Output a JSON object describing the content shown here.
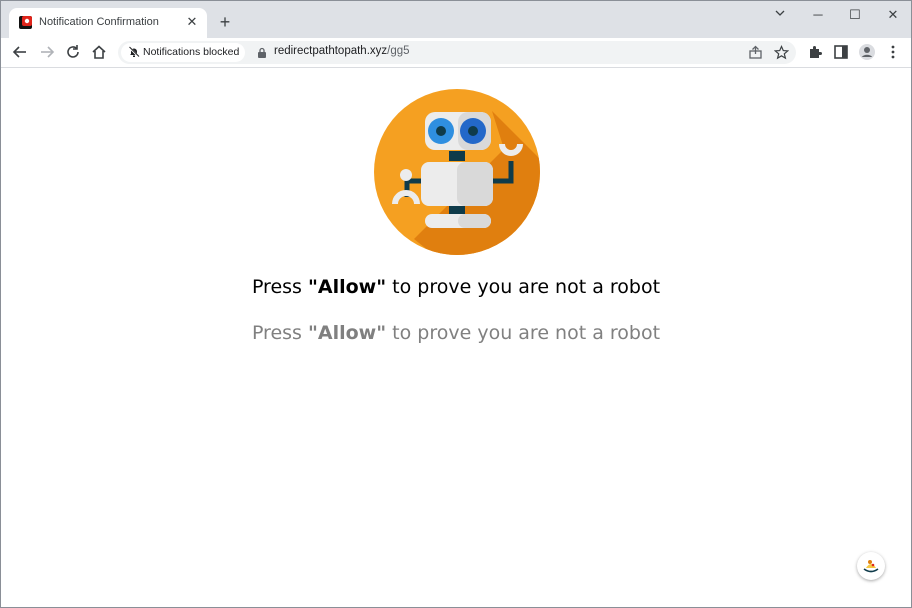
{
  "tab": {
    "title": "Notification Confirmation",
    "close": "✕"
  },
  "new_tab": "+",
  "window_controls": {
    "minimize": "─",
    "maximize": "☐",
    "close": "✕"
  },
  "toolbar": {
    "notifications_chip": "Notifications blocked",
    "url_host": "redirectpathtopath.xyz",
    "url_path": "/gg5"
  },
  "page": {
    "line1_prefix": "Press ",
    "line1_bold": "\"Allow\"",
    "line1_suffix": " to prove you are not a robot",
    "line2_prefix": "Press ",
    "line2_bold": "\"Allow\"",
    "line2_suffix": " to prove you are not a robot"
  },
  "colors": {
    "robot_circle": "#f5a021",
    "robot_shadow": "#e07f0f",
    "tabstrip": "#dee1e6",
    "eye_blue": "#2f8fe0",
    "dark_teal": "#0f3b4a"
  },
  "icons": [
    "back-icon",
    "forward-icon",
    "reload-icon",
    "home-icon",
    "bell-off-icon",
    "lock-icon",
    "share-icon",
    "star-icon",
    "extensions-icon",
    "side-panel-icon",
    "profile-icon",
    "menu-icon"
  ]
}
